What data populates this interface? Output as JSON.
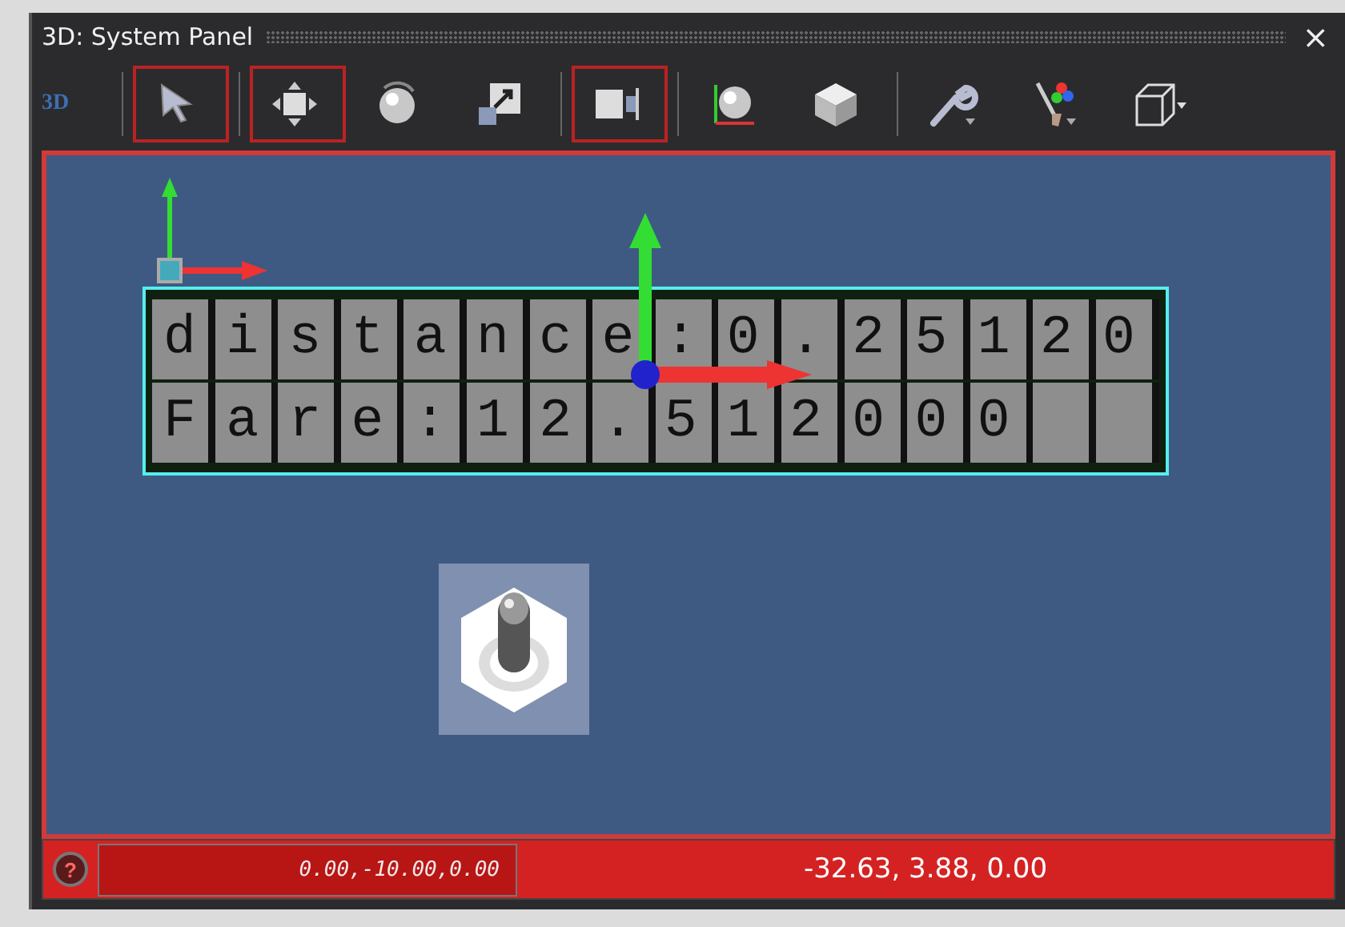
{
  "window": {
    "title": "3D: System Panel",
    "close": "×"
  },
  "toolbar": {
    "logo": "3D",
    "tools": [
      {
        "kind": "select",
        "selected": true
      },
      {
        "kind": "move",
        "selected": true
      },
      {
        "kind": "rotate",
        "selected": false
      },
      {
        "kind": "scale",
        "selected": false
      },
      {
        "kind": "align",
        "selected": true
      },
      {
        "kind": "axes-sphere",
        "selected": false
      },
      {
        "kind": "cube",
        "selected": false
      },
      {
        "kind": "wrench",
        "selected": false
      },
      {
        "kind": "brush",
        "selected": false
      },
      {
        "kind": "wire-cube",
        "selected": false
      }
    ]
  },
  "viewport": {
    "display": {
      "lines": [
        "distance:0.25120",
        "Fare:12.512000"
      ]
    }
  },
  "status_bar": {
    "help": "?",
    "position": "0.00,-10.00,0.00",
    "coordinates": "-32.63, 3.88, 0.00"
  }
}
